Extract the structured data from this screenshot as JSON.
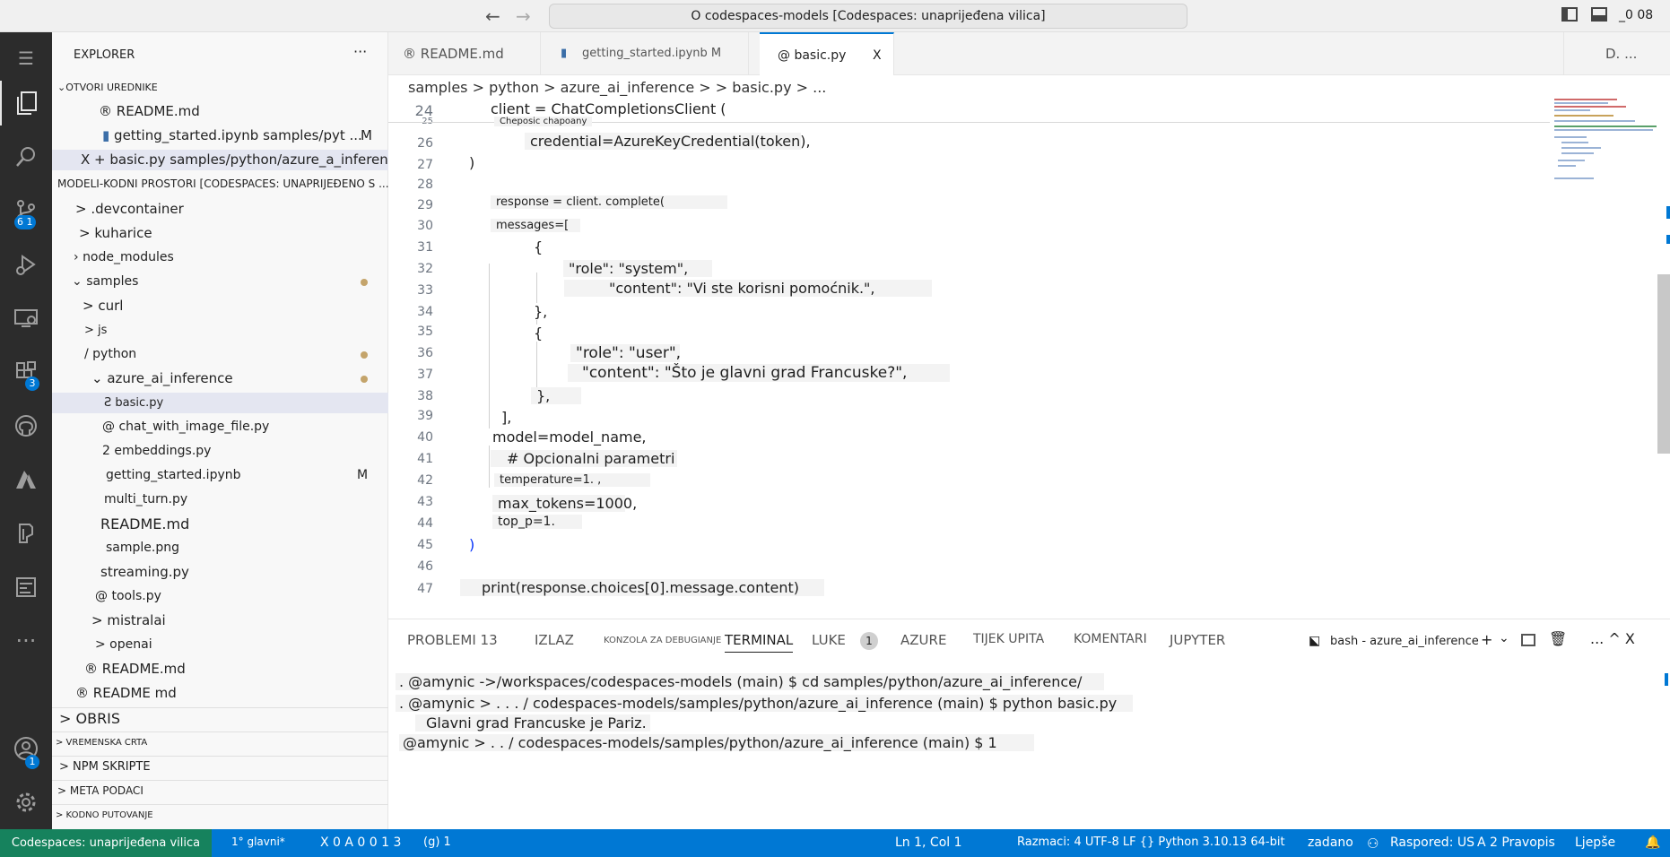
{
  "titlebar": {
    "back": "←",
    "forward": "→",
    "command_center": "O codespaces-models [Codespaces: unaprijeđena vilica]",
    "right_text": "_0 08"
  },
  "activity": {
    "scm_badge": "6 1",
    "extensions_badge": "3",
    "accounts_badge": "1"
  },
  "explorer": {
    "title": "EXPLORER",
    "more": "···",
    "open_editors_header": "OTVORI UREDNIKE",
    "open_editors": [
      {
        "label": "® README.md",
        "status": ""
      },
      {
        "label": "getting_started.ipynb samples/pyt ...",
        "status": "M"
      },
      {
        "label": "X + basic.py samples/python/azure_a_inference",
        "status": ""
      }
    ],
    "workspace_header": "MODELI-KODNI PROSTORI [CODESPACES: UNAPRIJEĐENO S ...",
    "tree": [
      "> .devcontainer",
      "> kuharice",
      "node_modules",
      "samples",
      "> curl",
      "> js",
      "/ python",
      "azure_ai_inference",
      "Ƨ basic.py",
      "@ chat_with_image_file.py",
      "2 embeddings.py",
      "getting_started.ipynb",
      "multi_turn.py",
      "README.md",
      "sample.png",
      "streaming.py",
      "@ tools.py",
      "> mistralai",
      "> openai",
      "® README.md",
      "® README md"
    ],
    "getting_started_status": "M",
    "outline": "> OBRIS",
    "timeline": "> VREMENSKA CRTA",
    "npm": "> NPM SKRIPTE",
    "metadata": "> META PODACI",
    "codetour": "> KODNO PUTOVANJE"
  },
  "tabs": [
    {
      "label": "® README.md"
    },
    {
      "label": "getting_started.ipynb M"
    },
    {
      "label": "@ basic.py"
    }
  ],
  "tab_close": "X",
  "tab_right": "D. ...",
  "breadcrumb": "samples > python > azure_ai_inference > > basic.py > ...",
  "code": {
    "line_numbers": [
      "24",
      "25",
      "26",
      "27",
      "28",
      "29",
      "30",
      "31",
      "32",
      "33",
      "34",
      "35",
      "36",
      "37",
      "38",
      "39",
      "40",
      "41",
      "42",
      "43",
      "44",
      "45",
      "46",
      "47"
    ],
    "lines": {
      "l24": "client = ChatCompletionsClient (",
      "l25": "Cheposic chapoany",
      "l26": "credential=AzureKeyCredential(token),",
      "l27": ")",
      "l29": "response = client. complete(",
      "l30": "messages=[",
      "l31": "{",
      "l32": "\"role\": \"system\",",
      "l33": "\"content\": \"Vi ste korisni pomoćnik.\",",
      "l34": "},",
      "l35": "{",
      "l36": "\"role\": \"user\",",
      "l37": "\"content\": \"Što je glavni grad Francuske?\",",
      "l38": "},",
      "l39": "],",
      "l40": "model=model_name,",
      "l41": "# Opcionalni parametri",
      "l42": "temperature=1. ,",
      "l43": "max_tokens=1000,",
      "l44": "top_p=1.",
      "l45": ")",
      "l47": "print(response.choices[0].message.content)"
    }
  },
  "panel": {
    "tabs": {
      "problems": "PROBLEMI 13",
      "output": "IZLAZ",
      "debug": "KONZOLA ZA DEBUGIANJE",
      "terminal": "TERMINAL",
      "ports": "LUKE",
      "ports_badge": "1",
      "azure": "AZURE",
      "flow": "TIJEK UPITA",
      "comments": "KOMENTARI",
      "jupyter": "JUPYTER"
    },
    "terminal_name": "bash - azure_ai_inference",
    "terminal_add": "+",
    "terminal_more": "... ^ X",
    "terminal_lines": [
      ". @amynic ->/workspaces/codespaces-models (main) $ cd samples/python/azure_ai_inference/",
      ". @amynic > . . . / codespaces-models/samples/python/azure_ai_inference (main) $ python basic.py",
      "Glavni grad Francuske je Pariz.",
      "@amynic > . . / codespaces-models/samples/python/azure_ai_inference (main) $ 1"
    ]
  },
  "statusbar": {
    "remote": "Codespaces: unaprijeđena vilica",
    "branch": "1° glavni*",
    "problems": "X 0 A 0 0 1 3",
    "ports": "(g) 1",
    "position": "Ln 1, Col 1",
    "encoding": "Razmaci: 4 UTF-8 LF {} Python 3.10.13 64-bit",
    "zadano": "zadano",
    "layout": "Raspored: US",
    "spell": "A 2 Pravopis",
    "prettier": "Ljepše"
  }
}
